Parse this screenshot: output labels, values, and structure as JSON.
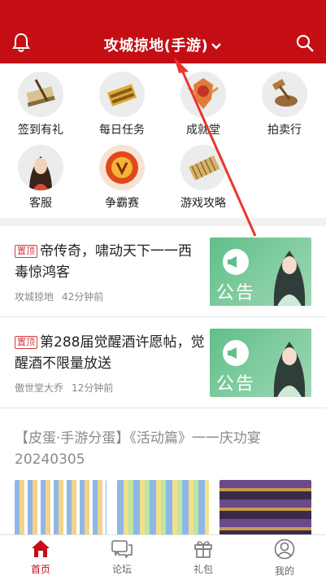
{
  "header": {
    "title": "攻城掠地(手游)",
    "bell_icon": "bell-icon",
    "search_icon": "search-icon",
    "dropdown_icon": "chevron-down-icon",
    "bg_color": "#c40e14"
  },
  "grid": {
    "items": [
      {
        "label": "签到有礼",
        "icon": "scroll-brush-icon"
      },
      {
        "label": "每日任务",
        "icon": "gold-scroll-icon"
      },
      {
        "label": "成就堂",
        "icon": "crest-icon"
      },
      {
        "label": "拍卖行",
        "icon": "hammer-bowl-icon"
      },
      {
        "label": "客服",
        "icon": "service-girl-icon"
      },
      {
        "label": "争霸赛",
        "icon": "fire-emblem-icon"
      },
      {
        "label": "游戏攻略",
        "icon": "bamboo-scroll-icon"
      }
    ]
  },
  "posts": [
    {
      "pin": "置顶",
      "title": "帝传奇，啸动天下一一西毒惊鸿客",
      "author": "攻城掠地",
      "time": "42分钟前",
      "thumb_text": "公告"
    },
    {
      "pin": "置顶",
      "title": "第288届觉醒酒许愿帖，觉醒酒不限量放送",
      "author": "傲世堂大乔",
      "time": "12分钟前",
      "thumb_text": "公告"
    }
  ],
  "post3": {
    "title": "【皮蛋·手游分蛋】《活动篇》一一庆功宴20240305"
  },
  "tabbar": {
    "tabs": [
      {
        "label": "首页",
        "icon": "home-icon",
        "active": true
      },
      {
        "label": "论坛",
        "icon": "chat-icon",
        "active": false
      },
      {
        "label": "礼包",
        "icon": "gift-icon",
        "active": false
      },
      {
        "label": "我的",
        "icon": "user-icon",
        "active": false
      }
    ],
    "active_color": "#c40e14"
  }
}
